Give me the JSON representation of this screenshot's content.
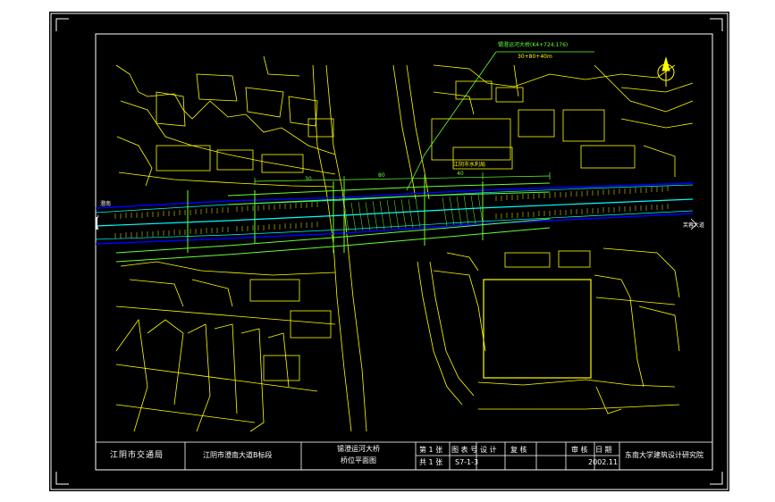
{
  "drawing": {
    "bridge_callout": "锡澄运河大桥(K4+724.176)",
    "span_arrangement": "30+80+40m",
    "road_label_left": "澄南",
    "road_label_right": "芙蓉大道",
    "dimension_top": "80",
    "dimension_segment": "40",
    "dimension_left": "30",
    "building_label": "江阴市水利局",
    "north_label": "N"
  },
  "title_block": {
    "client": "江阴市交通局",
    "project": "江阴市澄南大道B标段",
    "drawing_title_line1": "锡澄运河大桥",
    "drawing_title_line2": "桥位平面图",
    "sheet_no_label": "第 1 张",
    "total_sheets_label": "共 1 张",
    "drawing_no_label": "图 表 号",
    "drawing_no_value": "S7-1-3",
    "design_label": "设 计",
    "review_label": "复 核",
    "audit_label": "审 核",
    "date_label": "日 期",
    "date_value": "2002.11",
    "institute": "东南大学建筑设计研究院"
  },
  "colors": {
    "background": "#000000",
    "frame": "#ffffff",
    "basemap": "#ffff00",
    "alignment": "#00ffff",
    "bridge": "#66ff33",
    "road_edge": "#0000ff",
    "callout": "#00ff00"
  }
}
